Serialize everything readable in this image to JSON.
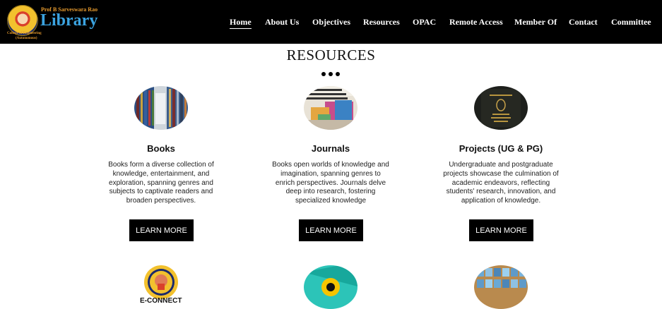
{
  "header": {
    "logo_top": "Prof B Sarveswara Rao",
    "logo_main": "Library",
    "logo_sub1": "College of Engineering",
    "logo_sub2": "(Autonomous)",
    "nav": [
      {
        "label": "Home"
      },
      {
        "label": "About Us"
      },
      {
        "label": "Objectives"
      },
      {
        "label": "Resources"
      },
      {
        "label": "OPAC"
      },
      {
        "label": "Remote Access"
      },
      {
        "label": "Member Of"
      },
      {
        "label": "Contact"
      },
      {
        "label": "Committee"
      }
    ]
  },
  "section": {
    "title": "RESOURCES"
  },
  "cards": [
    {
      "title": "Books",
      "description": "Books form a diverse collection of knowledge, entertainment, and exploration, spanning genres and subjects to captivate readers and broaden perspectives.",
      "button": "LEARN MORE",
      "image": "library-bookshelves-image"
    },
    {
      "title": "Journals",
      "description": "Books open worlds of knowledge and imagination, spanning genres to enrich perspectives. Journals delve deep into research, fostering specialized knowledge",
      "button": "LEARN MORE",
      "image": "journals-cover-image"
    },
    {
      "title": "Projects (UG & PG)",
      "description": "Undergraduate and postgraduate projects showcase the culmination of academic endeavors, reflecting students' research, innovation, and application of knowledge.",
      "button": "LEARN MORE",
      "image": "bound-project-report-image"
    }
  ],
  "next_row": [
    {
      "image": "college-seal-image",
      "label": "E-CONNECT"
    },
    {
      "image": "teal-circle-logo-image"
    },
    {
      "image": "library-bookshelf-image"
    }
  ],
  "colors": {
    "nav_bg": "#000000",
    "brand_blue": "#3ba3e0",
    "brand_orange": "#e69a2e",
    "button_bg": "#000000",
    "button_text": "#ffffff"
  }
}
